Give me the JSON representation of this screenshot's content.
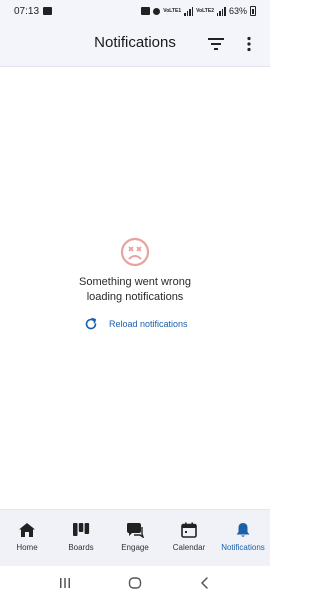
{
  "status_bar": {
    "time": "07:13",
    "battery_percent": "63%",
    "network_labels": [
      "VoLTE1",
      "VoLTE2"
    ]
  },
  "header": {
    "title": "Notifications",
    "filter_icon": "filter-icon",
    "more_icon": "more-vert-icon"
  },
  "error": {
    "icon": "sad-face-icon",
    "message": "Something went wrong loading notifications",
    "reload_label": "Reload notifications"
  },
  "bottom_nav": {
    "items": [
      {
        "label": "Home",
        "icon": "home-icon",
        "active": false
      },
      {
        "label": "Boards",
        "icon": "boards-icon",
        "active": false
      },
      {
        "label": "Engage",
        "icon": "engage-icon",
        "active": false
      },
      {
        "label": "Calendar",
        "icon": "calendar-icon",
        "active": false
      },
      {
        "label": "Notifications",
        "icon": "bell-icon",
        "active": true
      }
    ]
  },
  "colors": {
    "accent": "#1a5fa8",
    "error_icon": "#e8a3a0",
    "header_bg": "#f3f5fa"
  }
}
